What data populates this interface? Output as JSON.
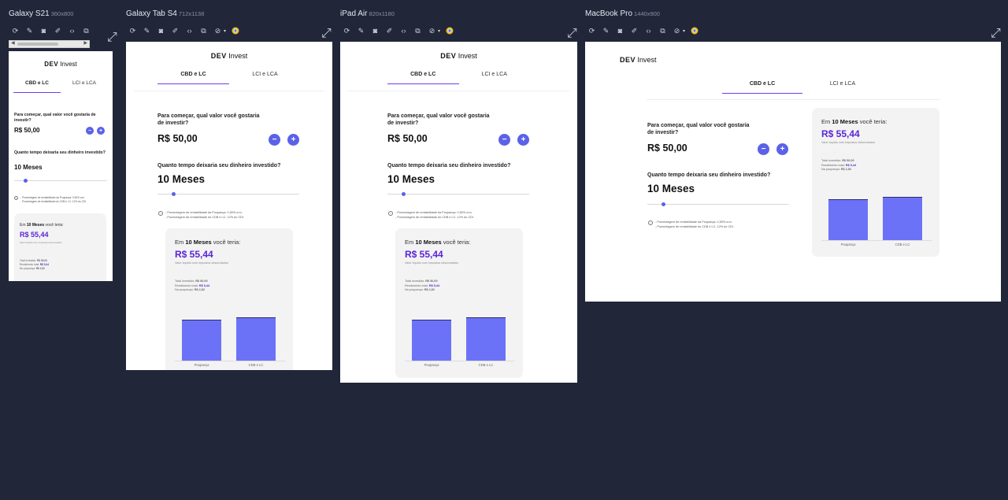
{
  "devices": [
    {
      "name": "Galaxy S21",
      "dims": "360x800"
    },
    {
      "name": "Galaxy Tab S4",
      "dims": "712x1138"
    },
    {
      "name": "iPad Air",
      "dims": "820x1180"
    },
    {
      "name": "MacBook Pro",
      "dims": "1440x900"
    }
  ],
  "toolbar_icons": [
    "refresh-icon",
    "edit-icon",
    "camera-icon",
    "brush-icon",
    "code-icon",
    "layout-icon",
    "eye-off-icon",
    "chrome-icon",
    "expand-icon"
  ],
  "app": {
    "logo_dev": "DEV",
    "logo_invest": "Invest",
    "tabs": [
      "CBD e LC",
      "LCI e LCA"
    ],
    "question_amount": "Para começar, qual valor você gostaria de investir?",
    "amount": "R$ 50,00",
    "question_time": "Quanto tempo deixaria seu dinheiro investido?",
    "months": "10 Meses",
    "slider_fraction": 0.1,
    "note_1": "- Porcentagem de rentabilidade da Poupança: 0,50% a.m.",
    "note_2": "- Porcentagem de rentabilidade do CDB e LC: 12% do CDI.",
    "card_prefix": "Em",
    "card_months": "10 Meses",
    "card_suffix": "você teria:",
    "result": "R$ 55,44",
    "result_sub": "Valor líquido com impostos descontados",
    "total_label": "Total investido:",
    "total_value": "R$ 50,00",
    "yield_label": "Rendimento total:",
    "yield_value": "R$ 5,44",
    "savings_label": "Na poupança:",
    "savings_value": "R$ 2,52",
    "bar_labels": [
      "Poupança",
      "CDB e LC"
    ],
    "bar_values": [
      52.52,
      55.44
    ]
  },
  "colors": {
    "accent": "#5a25d8",
    "bar": "#6c72f7",
    "button": "#5b62e8",
    "background": "#212639"
  }
}
